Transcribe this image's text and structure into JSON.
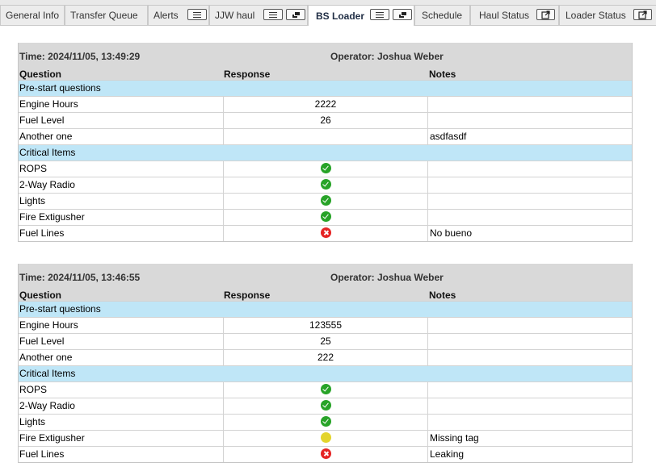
{
  "tabs": [
    {
      "label": "General Info",
      "buttons": []
    },
    {
      "label": "Transfer Queue",
      "buttons": []
    },
    {
      "label": "Alerts",
      "buttons": [
        "list-icon"
      ]
    },
    {
      "label": "JJW haul",
      "buttons": [
        "list-icon",
        "cards-icon"
      ]
    },
    {
      "label": "BS Loader",
      "active": true,
      "buttons": [
        "list-icon",
        "cards-icon"
      ]
    },
    {
      "label": "Schedule",
      "buttons": []
    },
    {
      "label": "Haul Status",
      "buttons": [
        "external-link-icon"
      ]
    },
    {
      "label": "Loader Status",
      "buttons": [
        "external-link-icon"
      ]
    }
  ],
  "columns": {
    "question": "Question",
    "response": "Response",
    "notes": "Notes"
  },
  "records": [
    {
      "time": "Time: 2024/11/05, 13:49:29",
      "operator": "Operator: Joshua Weber",
      "sections": [
        {
          "title": "Pre-start questions",
          "rows": [
            {
              "question": "Engine Hours",
              "response": "2222",
              "notes": ""
            },
            {
              "question": "Fuel Level",
              "response": "26",
              "notes": ""
            },
            {
              "question": "Another one",
              "response": "",
              "notes": "asdfasdf"
            }
          ]
        },
        {
          "title": "Critical Items",
          "rows": [
            {
              "question": "ROPS",
              "status": "ok",
              "notes": ""
            },
            {
              "question": "2-Way Radio",
              "status": "ok",
              "notes": ""
            },
            {
              "question": "Lights",
              "status": "ok",
              "notes": ""
            },
            {
              "question": "Fire Extigusher",
              "status": "ok",
              "notes": ""
            },
            {
              "question": "Fuel Lines",
              "status": "fail",
              "notes": "No bueno"
            }
          ]
        }
      ]
    },
    {
      "time": "Time: 2024/11/05, 13:46:55",
      "operator": "Operator: Joshua Weber",
      "sections": [
        {
          "title": "Pre-start questions",
          "rows": [
            {
              "question": "Engine Hours",
              "response": "123555",
              "notes": ""
            },
            {
              "question": "Fuel Level",
              "response": "25",
              "notes": ""
            },
            {
              "question": "Another one",
              "response": "222",
              "notes": ""
            }
          ]
        },
        {
          "title": "Critical Items",
          "rows": [
            {
              "question": "ROPS",
              "status": "ok",
              "notes": ""
            },
            {
              "question": "2-Way Radio",
              "status": "ok",
              "notes": ""
            },
            {
              "question": "Lights",
              "status": "ok",
              "notes": ""
            },
            {
              "question": "Fire Extigusher",
              "status": "warn",
              "notes": "Missing tag"
            },
            {
              "question": "Fuel Lines",
              "status": "fail",
              "notes": "Leaking"
            }
          ]
        }
      ]
    }
  ],
  "status_colors": {
    "ok": "#27a327",
    "warn": "#e3d42c",
    "fail": "#e52424"
  }
}
